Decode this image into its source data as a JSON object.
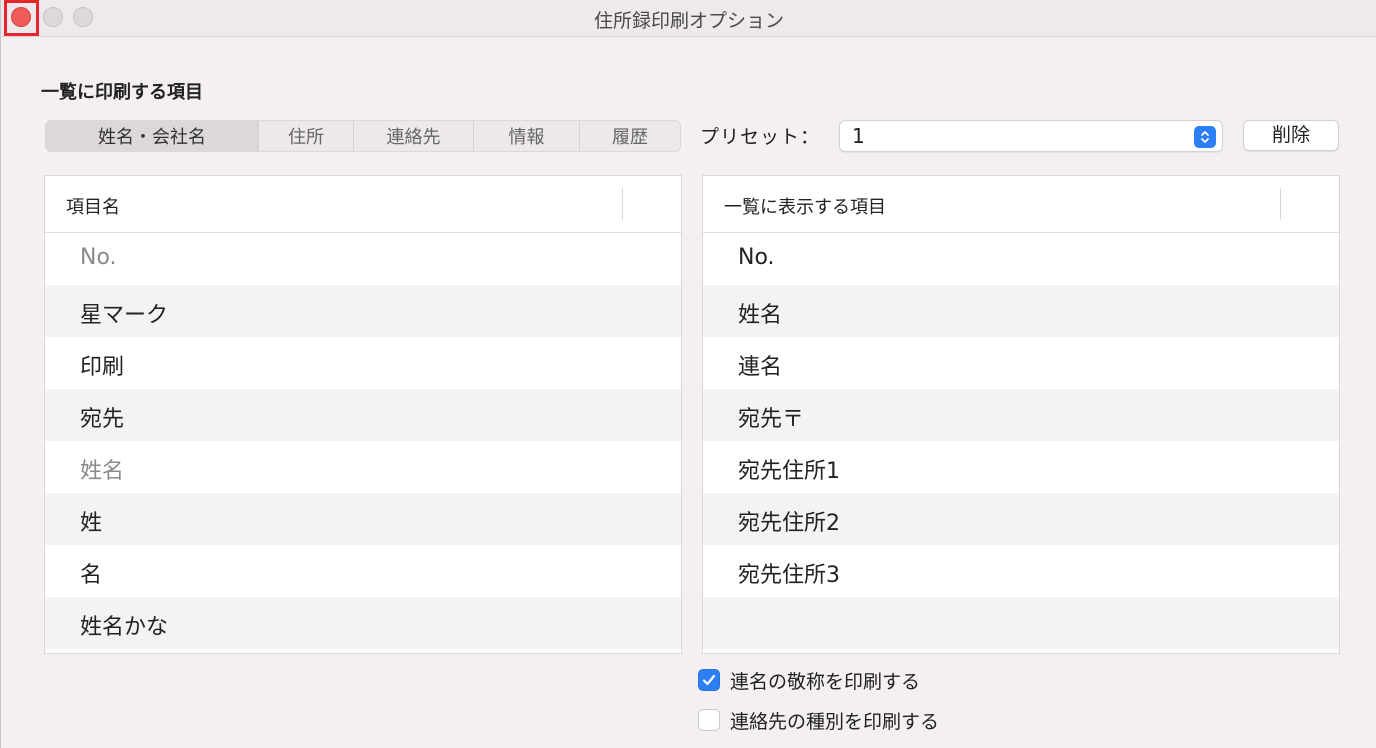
{
  "window": {
    "title": "住所録印刷オプション"
  },
  "section_title": "一覧に印刷する項目",
  "tabs": [
    {
      "label": "姓名・会社名",
      "active": true
    },
    {
      "label": "住所",
      "active": false
    },
    {
      "label": "連絡先",
      "active": false
    },
    {
      "label": "情報",
      "active": false
    },
    {
      "label": "履歴",
      "active": false
    }
  ],
  "preset": {
    "label": "プリセット：",
    "value": "1",
    "delete_label": "削除"
  },
  "left_table": {
    "header": "項目名",
    "rows": [
      {
        "label": "No.",
        "dim": true
      },
      {
        "label": "星マーク",
        "dim": false
      },
      {
        "label": "印刷",
        "dim": false
      },
      {
        "label": "宛先",
        "dim": false
      },
      {
        "label": "姓名",
        "dim": true
      },
      {
        "label": "姓",
        "dim": false
      },
      {
        "label": "名",
        "dim": false
      },
      {
        "label": "姓名かな",
        "dim": false
      }
    ]
  },
  "right_table": {
    "header": "一覧に表示する項目",
    "rows": [
      {
        "label": "No."
      },
      {
        "label": "姓名"
      },
      {
        "label": "連名"
      },
      {
        "label": "宛先〒"
      },
      {
        "label": "宛先住所1"
      },
      {
        "label": "宛先住所2"
      },
      {
        "label": "宛先住所3"
      },
      {
        "label": ""
      }
    ]
  },
  "options": [
    {
      "label": "連名の敬称を印刷する",
      "checked": true
    },
    {
      "label": "連絡先の種別を印刷する",
      "checked": false
    }
  ],
  "colors": {
    "accent": "#2d7ff5",
    "close_button": "#ee5b58",
    "highlight_outline": "#e5262b"
  }
}
